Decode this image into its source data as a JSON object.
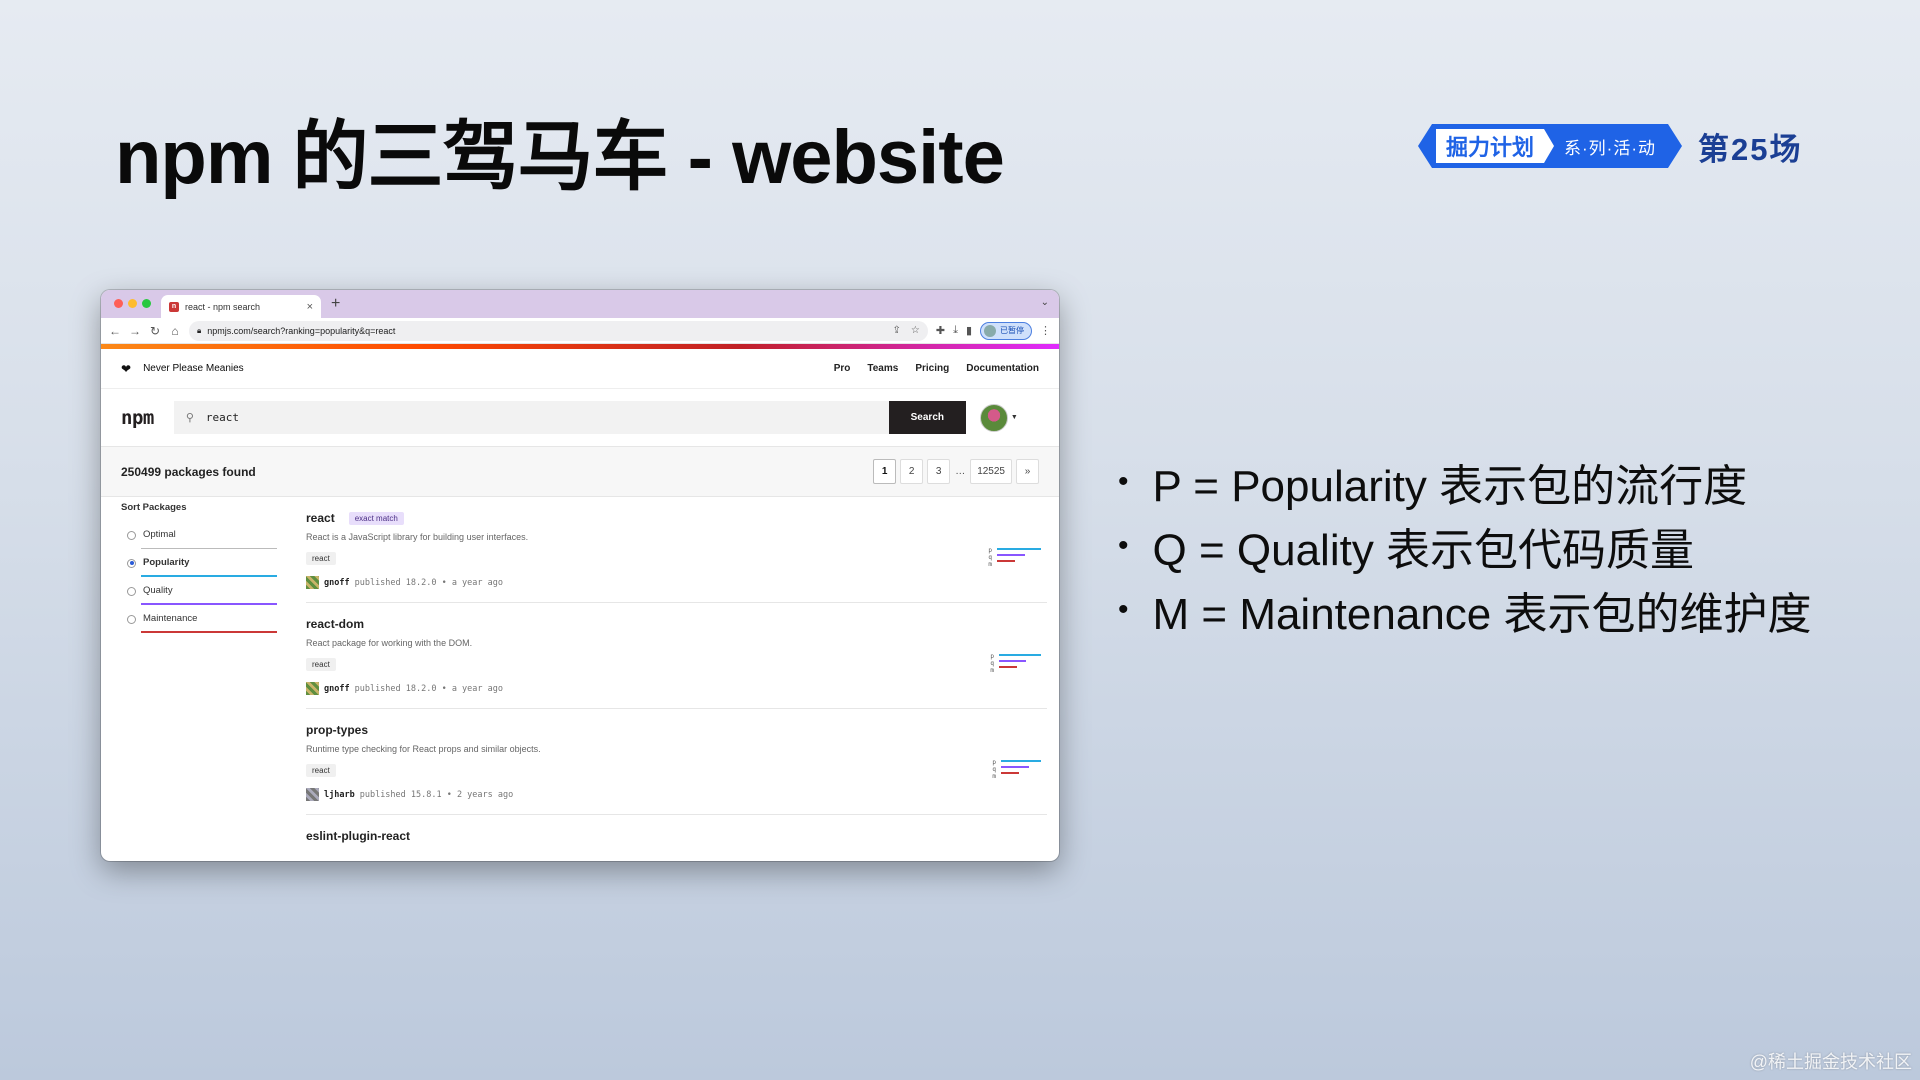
{
  "slide": {
    "title": "npm 的三驾马车 - website",
    "brand": {
      "main": "掘力计划",
      "sub": "系·列·活·动",
      "num": "第25场"
    },
    "bullets": [
      "P = Popularity 表示包的流行度",
      "Q = Quality 表示包代码质量",
      "M = Maintenance 表示包的维护度"
    ],
    "watermark": "@稀土掘金技术社区"
  },
  "browser": {
    "tab_title": "react - npm search",
    "tab_close": "×",
    "new_tab": "+",
    "url": "npmjs.com/search?ranking=popularity&q=react",
    "profile_label": "已暂停"
  },
  "npm": {
    "tagline": "Never Please Meanies",
    "nav": [
      "Pro",
      "Teams",
      "Pricing",
      "Documentation"
    ],
    "logo": "npm",
    "search_value": "react",
    "search_button": "Search",
    "results_count": "250499 packages found",
    "pagination": [
      "1",
      "2",
      "3",
      "…",
      "12525",
      "»"
    ],
    "sort_title": "Sort Packages",
    "sort_options": [
      "Optimal",
      "Popularity",
      "Quality",
      "Maintenance"
    ],
    "selected_sort": "Popularity",
    "packages": [
      {
        "name": "react",
        "badge": "exact match",
        "description": "React is a JavaScript library for building user interfaces.",
        "keyword": "react",
        "user": "gnoff",
        "published": "published 18.2.0 • a year ago"
      },
      {
        "name": "react-dom",
        "badge": "",
        "description": "React package for working with the DOM.",
        "keyword": "react",
        "user": "gnoff",
        "published": "published 18.2.0 • a year ago"
      },
      {
        "name": "prop-types",
        "badge": "",
        "description": "Runtime type checking for React props and similar objects.",
        "keyword": "react",
        "user": "ljharb",
        "published": "published 15.8.1 • 2 years ago"
      },
      {
        "name": "eslint-plugin-react"
      }
    ],
    "score_letters": [
      "p",
      "q",
      "m"
    ],
    "colors": {
      "popularity": "#29abe2",
      "quality": "#8956ff",
      "maintenance": "#cb3837",
      "brand_blue": "#1f63e6"
    }
  }
}
